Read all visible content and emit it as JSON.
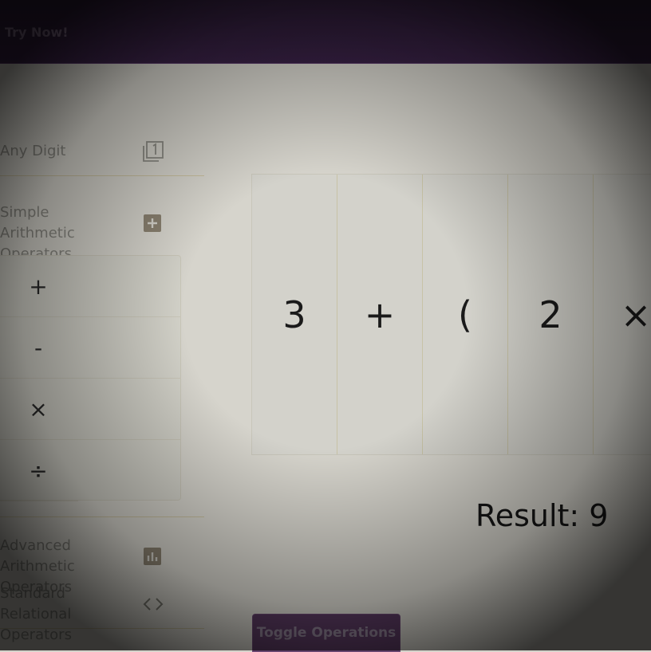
{
  "header": {
    "brand": "Try Now!"
  },
  "sidebar": {
    "sections": [
      {
        "label": "Any Digit",
        "icon": "digit-one-icon"
      },
      {
        "label": "Simple Arithmetic Operators",
        "icon": "plus-box-icon",
        "items": [
          "+",
          "-",
          "×",
          "÷"
        ]
      },
      {
        "label": "Advanced Arithmetic Operators",
        "icon": "bar-chart-icon"
      },
      {
        "label": "Standard Relational Operators",
        "icon": "angle-brackets-icon"
      }
    ]
  },
  "expression": {
    "tokens": [
      "3",
      "+",
      "(",
      "2",
      "×"
    ]
  },
  "result": {
    "label": "Result: 9"
  },
  "actions": {
    "toggle_label": "Toggle Operations"
  },
  "colors": {
    "header": "#3a2247",
    "button": "#5a3a61",
    "background": "#d6d4cc"
  }
}
